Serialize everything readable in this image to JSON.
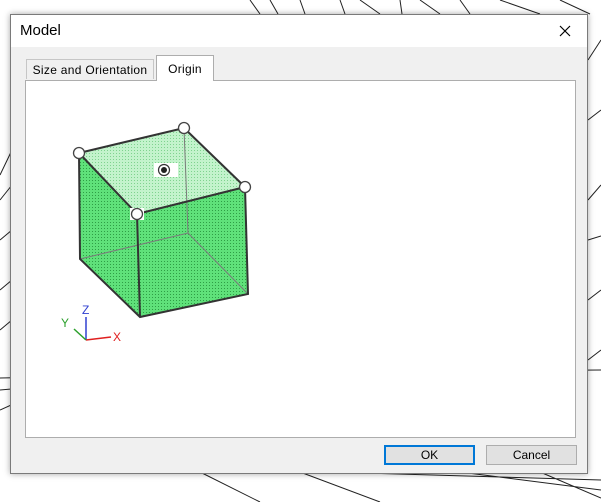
{
  "window": {
    "title": "Model"
  },
  "tabs": [
    {
      "label": "Size and Orientation",
      "active": false
    },
    {
      "label": "Origin",
      "active": true
    }
  ],
  "axes": {
    "x": "X",
    "y": "Y",
    "z": "Z"
  },
  "buttons": {
    "ok": "OK",
    "cancel": "Cancel"
  },
  "colors": {
    "cube_fill": "#5fe17a",
    "top_fill": "#b9f0c3",
    "x_axis": "#e02020",
    "y_axis": "#2ca02c",
    "z_axis": "#3040d0",
    "accent": "#0078d7"
  },
  "icons": {
    "close": "close-icon",
    "origin": "origin-point-icon",
    "handle": "resize-handle-icon"
  }
}
